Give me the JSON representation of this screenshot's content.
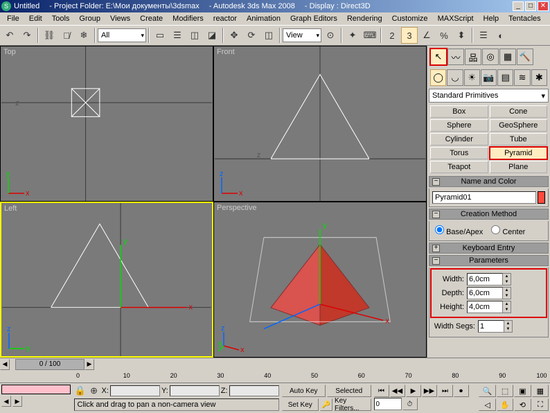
{
  "title": {
    "scene": "Untitled",
    "project": "- Project Folder: E:\\Мои документы\\3dsmax",
    "app": "- Autodesk 3ds Max 2008",
    "display": "- Display : Direct3D"
  },
  "menus": [
    "File",
    "Edit",
    "Tools",
    "Group",
    "Views",
    "Create",
    "Modifiers",
    "reactor",
    "Animation",
    "Graph Editors",
    "Rendering",
    "Customize",
    "MAXScript",
    "Help",
    "Tentacles"
  ],
  "toolbar": {
    "selection_set": "All",
    "ref_coord": "View"
  },
  "viewports": {
    "top": "Top",
    "front": "Front",
    "left": "Left",
    "perspective": "Perspective"
  },
  "create": {
    "category": "Standard Primitives",
    "objects": [
      "Box",
      "Cone",
      "Sphere",
      "GeoSphere",
      "Cylinder",
      "Tube",
      "Torus",
      "Pyramid",
      "Teapot",
      "Plane"
    ],
    "active": "Pyramid"
  },
  "rollouts": {
    "name_and_color": "Name and Color",
    "object_name": "Pyramid01",
    "object_color": "#ff4b3e",
    "creation_method": "Creation Method",
    "base_apex": "Base/Apex",
    "center": "Center",
    "keyboard_entry": "Keyboard Entry",
    "parameters": "Parameters",
    "width_label": "Width:",
    "width_val": "6,0cm",
    "depth_label": "Depth:",
    "depth_val": "6,0cm",
    "height_label": "Height:",
    "height_val": "4,0cm",
    "width_segs_label": "Width Segs:",
    "width_segs_val": "1"
  },
  "timeline": {
    "frame_display": "0 / 100",
    "ticks": [
      "0",
      "10",
      "20",
      "30",
      "40",
      "50",
      "60",
      "70",
      "80",
      "90",
      "100"
    ]
  },
  "bottom": {
    "x_label": "X:",
    "y_label": "Y:",
    "z_label": "Z:",
    "x_val": "",
    "y_val": "",
    "z_val": "",
    "status": "Click and drag to pan a non-camera view",
    "autokey": "Auto Key",
    "setkey": "Set Key",
    "selected": "Selected",
    "keyfilters": "Key Filters...",
    "cur_frame": "0"
  }
}
